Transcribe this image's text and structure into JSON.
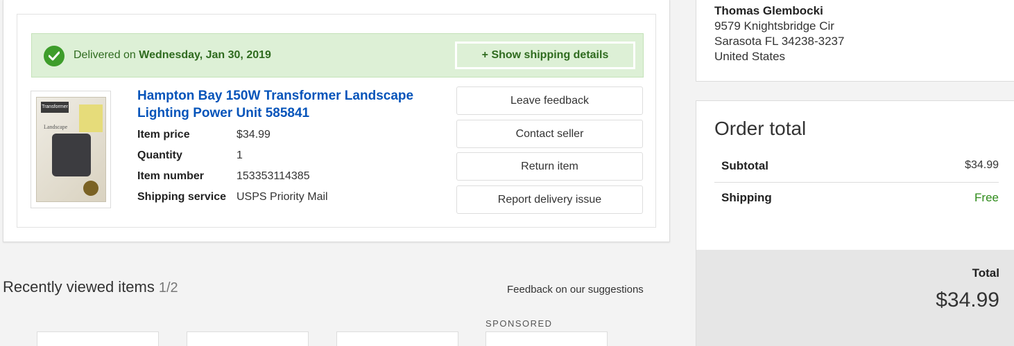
{
  "order": {
    "delivered_prefix": "Delivered on",
    "delivered_date": "Wednesday, Jan 30, 2019",
    "show_shipping_label": "+ Show shipping details",
    "item": {
      "title": "Hampton Bay 150W Transformer Landscape Lighting Power Unit 585841",
      "details": [
        {
          "label": "Item price",
          "value": "$34.99"
        },
        {
          "label": "Quantity",
          "value": "1"
        },
        {
          "label": "Item number",
          "value": "153353114385"
        },
        {
          "label": "Shipping service",
          "value": "USPS Priority Mail"
        }
      ],
      "image_text": {
        "brand": "Transformer",
        "label": "Landscape"
      }
    },
    "actions": [
      "Leave feedback",
      "Contact seller",
      "Return item",
      "Report delivery issue"
    ]
  },
  "recently_viewed": {
    "title": "Recently viewed items",
    "count": "1/2",
    "feedback_link": "Feedback on our suggestions",
    "sponsored": "SPONSORED"
  },
  "shipping_address": {
    "name": "Thomas Glembocki",
    "street": "9579 Knightsbridge Cir",
    "city_line": "Sarasota FL 34238-3237",
    "country": "United States"
  },
  "order_total": {
    "title": "Order total",
    "subtotal_label": "Subtotal",
    "subtotal_value": "$34.99",
    "shipping_label": "Shipping",
    "shipping_value": "Free",
    "total_label": "Total",
    "total_value": "$34.99"
  },
  "colors": {
    "link": "#0654ba",
    "delivered_bg": "#ddf0d6",
    "delivered_text": "#2f6b1f",
    "check": "#3e9d2b",
    "free": "#2e8b1a"
  },
  "icons": {
    "delivered": "check-circle-icon"
  }
}
